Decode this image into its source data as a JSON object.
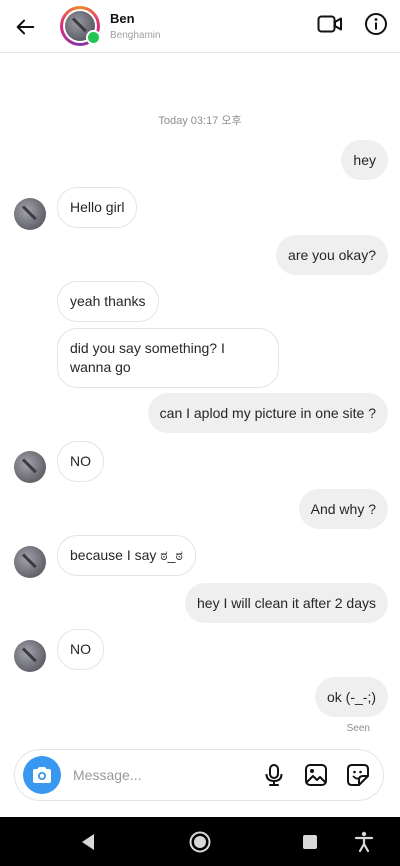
{
  "header": {
    "name": "Ben",
    "username": "Benghamin"
  },
  "chat": {
    "timestamp": "Today 03:17 오후",
    "messages": [
      {
        "from": "me",
        "text": "hey"
      },
      {
        "from": "them",
        "text": "Hello girl"
      },
      {
        "from": "me",
        "text": "are you okay?"
      },
      {
        "from": "them",
        "text": "yeah thanks"
      },
      {
        "from": "them",
        "text": "did you say something? I wanna go"
      },
      {
        "from": "me",
        "text": "can I aplod my picture in one site ?"
      },
      {
        "from": "them",
        "text": "NO"
      },
      {
        "from": "me",
        "text": "And why ?"
      },
      {
        "from": "them",
        "text": "because I say ಠ_ಠ"
      },
      {
        "from": "me",
        "text": "hey I will clean it after 2 days"
      },
      {
        "from": "them",
        "text": "NO"
      },
      {
        "from": "me",
        "text": "ok (-_-;)"
      }
    ],
    "seen_label": "Seen"
  },
  "composer": {
    "placeholder": "Message..."
  },
  "icons": {
    "back": "arrow-left-icon",
    "video": "video-camera-icon",
    "info": "info-icon",
    "camera": "camera-icon",
    "mic": "microphone-icon",
    "gallery": "image-icon",
    "sticker": "sticker-icon"
  },
  "colors": {
    "accent": "#3897f0",
    "online": "#23c552",
    "sent_bubble": "#efefef",
    "nav_bar": "#000000"
  }
}
